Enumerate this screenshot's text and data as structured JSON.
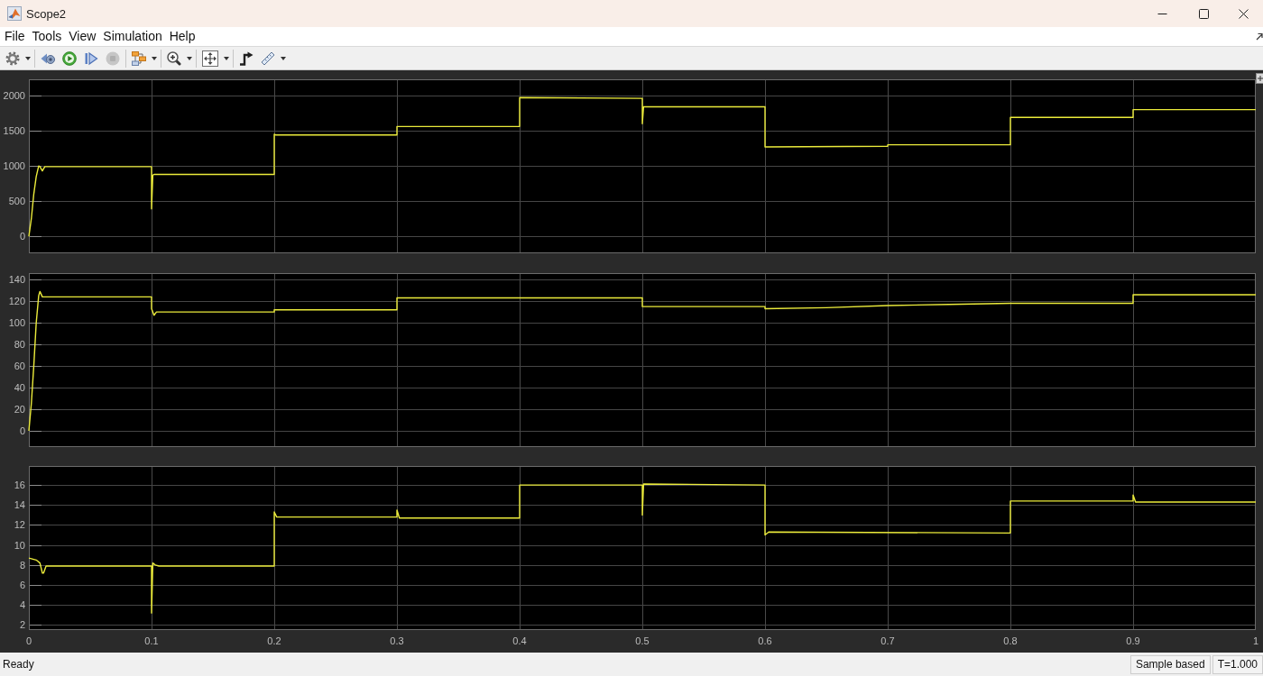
{
  "window": {
    "title": "Scope2"
  },
  "menu": [
    "File",
    "Tools",
    "View",
    "Simulation",
    "Help"
  ],
  "toolbar": [
    {
      "tools": [
        {
          "kind": "settings",
          "dropdown": true,
          "disabled": false
        }
      ]
    },
    {
      "tools": [
        {
          "kind": "step_back",
          "dropdown": false,
          "disabled": false
        },
        {
          "kind": "run",
          "dropdown": false,
          "disabled": false
        },
        {
          "kind": "step_forward",
          "dropdown": false,
          "disabled": false
        },
        {
          "kind": "stop",
          "dropdown": false,
          "disabled": true
        }
      ]
    },
    {
      "tools": [
        {
          "kind": "highlight",
          "dropdown": true,
          "disabled": false
        }
      ]
    },
    {
      "tools": [
        {
          "kind": "zoom",
          "dropdown": true,
          "disabled": false
        }
      ]
    },
    {
      "tools": [
        {
          "kind": "fit",
          "dropdown": true,
          "disabled": false
        }
      ]
    },
    {
      "tools": [
        {
          "kind": "trigger",
          "dropdown": false,
          "disabled": false
        },
        {
          "kind": "cursor",
          "dropdown": true,
          "disabled": false
        }
      ]
    }
  ],
  "plots": [
    {
      "chart_data": {
        "type": "line",
        "x": [
          0,
          0.002,
          0.004,
          0.006,
          0.008,
          0.009,
          0.011,
          0.013,
          0.1,
          0.1,
          0.101,
          0.102,
          0.2,
          0.2,
          0.201,
          0.3,
          0.3,
          0.4,
          0.4,
          0.5,
          0.5,
          0.501,
          0.502,
          0.6,
          0.6,
          0.7,
          0.7,
          0.8,
          0.8,
          0.9,
          0.9,
          1
        ],
        "values": [
          0,
          250,
          600,
          850,
          1000,
          990,
          930,
          990,
          990,
          390,
          870,
          880,
          880,
          1450,
          1440,
          1440,
          1560,
          1560,
          1970,
          1960,
          1600,
          1840,
          1840,
          1840,
          1270,
          1280,
          1300,
          1300,
          1690,
          1690,
          1800,
          1800
        ],
        "color": "#ebeb3b",
        "xlim": [
          0,
          1
        ],
        "ylim": [
          -240,
          2230
        ],
        "xticks": [
          0,
          0.1,
          0.2,
          0.3,
          0.4,
          0.5,
          0.6,
          0.7,
          0.8,
          0.9,
          1
        ],
        "yticks": [
          0,
          500,
          1000,
          1500,
          2000
        ],
        "tick_labels": "y",
        "grid": true
      }
    },
    {
      "chart_data": {
        "type": "line",
        "x": [
          0,
          0.002,
          0.004,
          0.006,
          0.008,
          0.009,
          0.011,
          0.1,
          0.1,
          0.102,
          0.104,
          0.2,
          0.2,
          0.3,
          0.3,
          0.4,
          0.5,
          0.5,
          0.6,
          0.6,
          0.65,
          0.7,
          0.75,
          0.8,
          0.9,
          0.9,
          1
        ],
        "values": [
          0,
          25,
          60,
          100,
          125,
          129,
          124,
          124,
          113,
          107,
          110,
          110,
          112,
          112,
          123,
          123,
          123,
          115,
          115,
          113,
          114,
          116,
          117,
          118,
          118,
          126,
          126
        ],
        "color": "#ebeb3b",
        "xlim": [
          0,
          1
        ],
        "ylim": [
          -15,
          146
        ],
        "xticks": [
          0,
          0.1,
          0.2,
          0.3,
          0.4,
          0.5,
          0.6,
          0.7,
          0.8,
          0.9,
          1
        ],
        "yticks": [
          0,
          20,
          40,
          60,
          80,
          100,
          120,
          140
        ],
        "tick_labels": "y",
        "grid": true
      }
    },
    {
      "chart_data": {
        "type": "line",
        "x": [
          0,
          0.006,
          0.009,
          0.011,
          0.012,
          0.014,
          0.1,
          0.1,
          0.101,
          0.103,
          0.106,
          0.2,
          0.2,
          0.202,
          0.3,
          0.3,
          0.302,
          0.4,
          0.4,
          0.5,
          0.5,
          0.501,
          0.6,
          0.6,
          0.603,
          0.8,
          0.8,
          0.9,
          0.9,
          0.902,
          1
        ],
        "values": [
          8.7,
          8.5,
          8.2,
          7.2,
          7.2,
          7.9,
          7.9,
          3.2,
          8.2,
          8.0,
          7.9,
          7.9,
          13.3,
          12.8,
          12.8,
          13.5,
          12.7,
          12.7,
          16,
          16,
          13,
          16.1,
          16,
          11,
          11.3,
          11.2,
          14.4,
          14.4,
          15,
          14.3,
          14.3
        ],
        "color": "#ebeb3b",
        "xlim": [
          0,
          1
        ],
        "ylim": [
          1.5,
          17.9
        ],
        "xticks": [
          0,
          0.1,
          0.2,
          0.3,
          0.4,
          0.5,
          0.6,
          0.7,
          0.8,
          0.9,
          1
        ],
        "yticks": [
          2,
          4,
          6,
          8,
          10,
          12,
          14,
          16
        ],
        "grid": true
      }
    }
  ],
  "status_bar": {
    "message": "Ready",
    "fields": [
      "Sample based",
      "T=1.000"
    ]
  }
}
